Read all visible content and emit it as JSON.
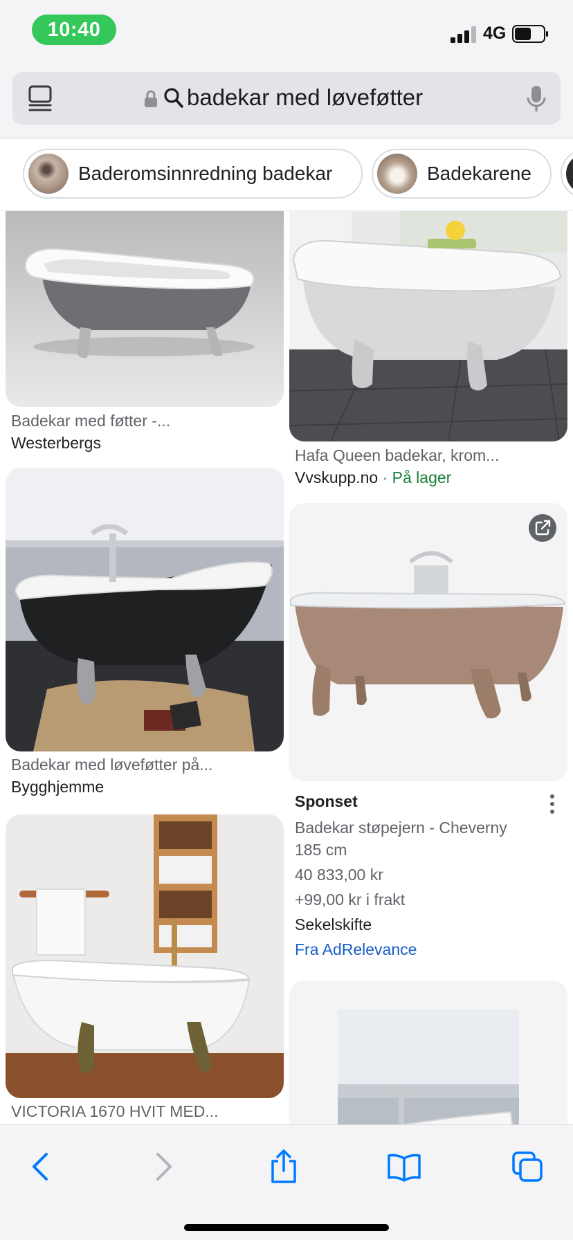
{
  "status": {
    "time": "10:40",
    "network": "4G"
  },
  "search": {
    "query": "badekar med løveføtter"
  },
  "chips": [
    {
      "label": "Baderomsinnredning badekar",
      "thumb_color": "#a08a7c"
    },
    {
      "label": "Badekarene",
      "thumb_color": "#8e7b6c"
    },
    {
      "label": "",
      "thumb_color": "#2b2b2b"
    }
  ],
  "results": [
    {
      "title": "Badekar med føtter -...",
      "source": "Westerbergs"
    },
    {
      "title": "Hafa Queen badekar, krom...",
      "source": "Vvskupp.no",
      "stock_separator": "·",
      "stock": "På lager"
    },
    {
      "title": "Badekar med løveføtter på...",
      "source": "Bygghjemme"
    },
    {
      "sponsored_label": "Sponset",
      "title_line1": "Badekar støpejern - Cheverny",
      "title_line2": "185 cm",
      "price": "40 833,00 kr",
      "shipping": "+99,00 kr i frakt",
      "seller": "Sekelskifte",
      "via": "Fra AdRelevance"
    },
    {
      "title": "VICTORIA 1670 HVIT MED..."
    }
  ],
  "colors": {
    "accent_blue": "#007aff",
    "link_blue": "#1a5fc8",
    "stock_green": "#188038",
    "status_green": "#34c759"
  },
  "icons": [
    "tabs-icon",
    "lock-icon",
    "search-icon",
    "mic-icon",
    "back-icon",
    "forward-icon",
    "share-icon",
    "bookmarks-icon",
    "tabs-overview-icon",
    "open-external-icon",
    "more-options-icon"
  ]
}
